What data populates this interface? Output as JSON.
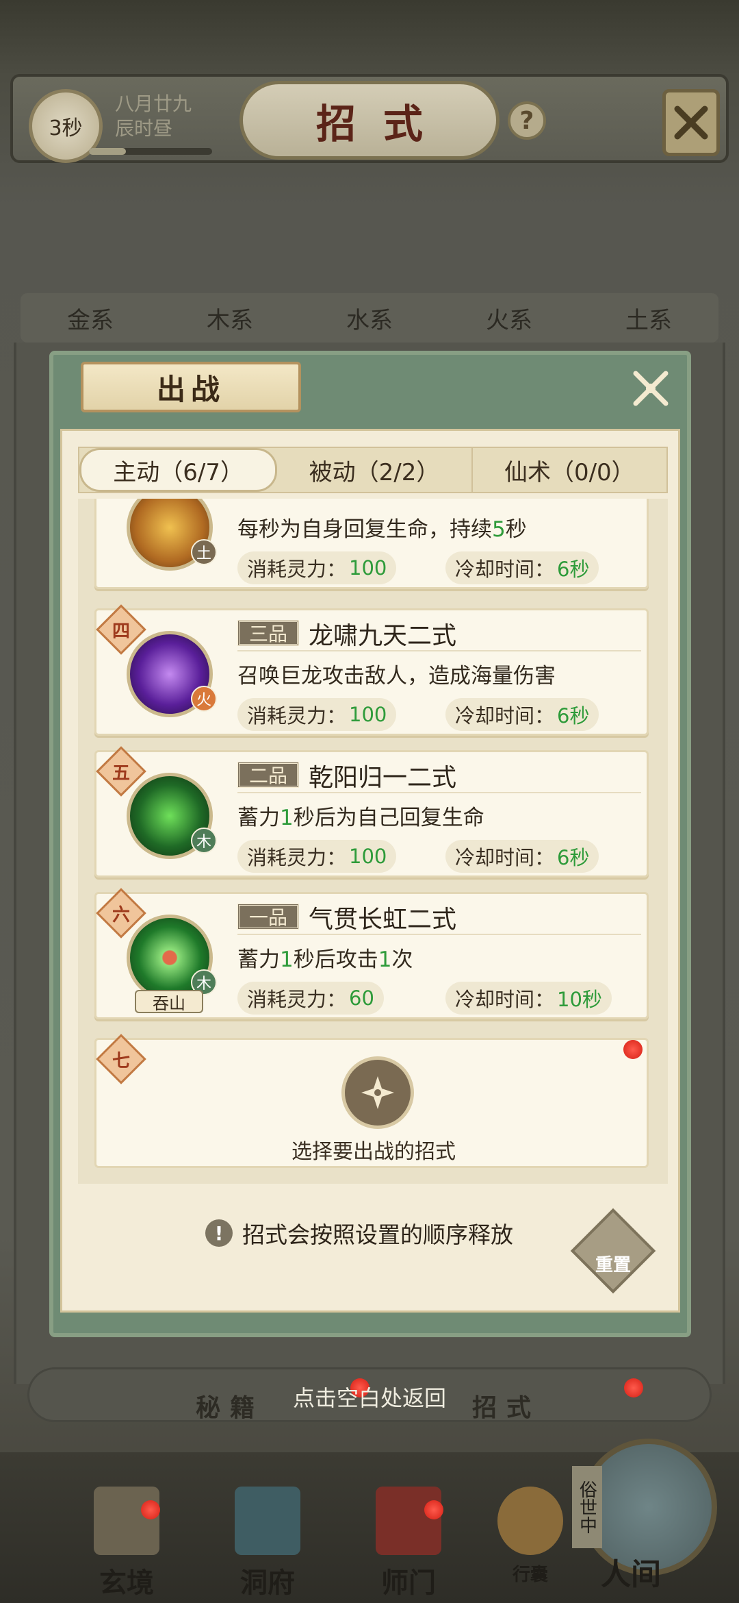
{
  "header": {
    "timer": "3秒",
    "date_line1": "八月廿九",
    "date_line2": "辰时昼",
    "title": "招式",
    "help": "?",
    "time_progress": 0.3
  },
  "element_tabs": [
    "金系",
    "木系",
    "水系",
    "火系",
    "土系"
  ],
  "modal": {
    "title": "出战",
    "tabs": [
      "主动（6/7）",
      "被动（2/2）",
      "仙术（0/0）"
    ],
    "cost_label": "消耗灵力：",
    "cooldown_label": "冷却时间：",
    "skills": [
      {
        "element": "土",
        "desc_parts": [
          "每秒为自身回复生命，持续",
          "5",
          "秒"
        ],
        "cost": "100",
        "cooldown": "6秒"
      },
      {
        "rank": "四",
        "grade": "三品",
        "name": "龙啸九天二式",
        "element": "火",
        "desc_parts": [
          "召唤巨龙攻击敌人，造成海量伤害"
        ],
        "cost": "100",
        "cooldown": "6秒"
      },
      {
        "rank": "五",
        "grade": "二品",
        "name": "乾阳归一二式",
        "element": "木",
        "desc_parts": [
          "蓄力",
          "1",
          "秒后为自己回复生命"
        ],
        "cost": "100",
        "cooldown": "6秒"
      },
      {
        "rank": "六",
        "grade": "一品",
        "name": "气贯长虹二式",
        "element": "木",
        "tag": "吞山",
        "desc_parts": [
          "蓄力",
          "1",
          "秒后攻击",
          "1",
          "次"
        ],
        "cost": "60",
        "cooldown": "10秒"
      }
    ],
    "empty_slot": {
      "rank": "七",
      "label": "选择要出战的招式"
    },
    "tip": "招式会按照设置的顺序释放",
    "reset": "重置"
  },
  "under": {
    "left": "秘籍",
    "right": "招式",
    "hint": "点击空白处返回"
  },
  "nav": {
    "items": [
      "玄境",
      "洞府",
      "师门",
      "行囊"
    ],
    "world": "人间",
    "world_tag": "俗世中"
  },
  "colors": {
    "accent_green": "#2e9b3a",
    "notice_red": "#d41f14"
  }
}
